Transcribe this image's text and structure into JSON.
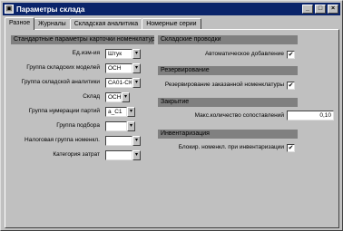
{
  "window": {
    "title": "Параметры склада"
  },
  "tabs": [
    "Разное",
    "Журналы",
    "Складская аналитика",
    "Номерные серии"
  ],
  "left_group": {
    "header": "Стандартные параметры карточки номенклатуры",
    "fields": [
      {
        "label": "Ед.изм-ия",
        "value": "Штук"
      },
      {
        "label": "Группа складских моделей",
        "value": "ОСН"
      },
      {
        "label": "Группа складской аналитики",
        "value": "СА01-СКЛ"
      },
      {
        "label": "Склад",
        "value": "ОСН"
      },
      {
        "label": "Группа нумерации партий",
        "value": "а_С1"
      },
      {
        "label": "Группа подбора",
        "value": ""
      },
      {
        "label": "Налоговая группа номенкл.",
        "value": ""
      },
      {
        "label": "Категория затрат",
        "value": ""
      }
    ]
  },
  "right_groups": {
    "sales_orders": {
      "header": "Складские проводки",
      "auto_add_label": "Автоматическое добавление",
      "auto_add_checked": "✔"
    },
    "reservation": {
      "header": "Резервирование",
      "reserve_label": "Резервирование заказанной номенклатуры",
      "reserve_checked": "✔"
    },
    "closing": {
      "header": "Закрытие",
      "max_label": "Макс.количество сопоставлений",
      "max_value": "0,10"
    },
    "inventory": {
      "header": "Инвентаризация",
      "block_label": "Блокир. номенкл. при инвентаризации",
      "block_checked": "✔"
    }
  }
}
